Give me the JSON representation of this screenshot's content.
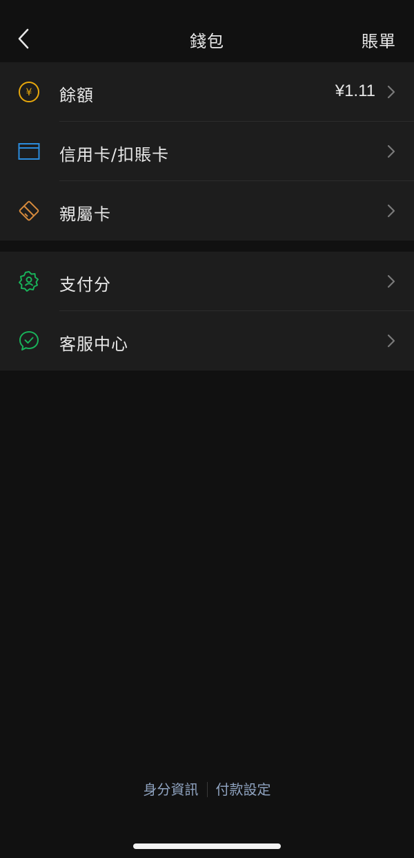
{
  "nav": {
    "back_icon": "chevron-left-icon",
    "title": "錢包",
    "bill_label": "賬單"
  },
  "groups": [
    {
      "items": [
        {
          "icon": "yuan-coin-icon",
          "label": "餘額",
          "value": "¥1.11",
          "color": "#e8a80c"
        },
        {
          "icon": "card-icon",
          "label": "信用卡/扣賬卡",
          "value": "",
          "color": "#2b8cdd"
        },
        {
          "icon": "family-card-icon",
          "label": "親屬卡",
          "value": "",
          "color": "#d68a3c"
        }
      ]
    },
    {
      "items": [
        {
          "icon": "pay-score-badge-icon",
          "label": "支付分",
          "value": "",
          "color": "#19b35a"
        },
        {
          "icon": "customer-service-icon",
          "label": "客服中心",
          "value": "",
          "color": "#19b35a"
        }
      ]
    }
  ],
  "footer": {
    "identity_label": "身分資訊",
    "payment_settings_label": "付款設定",
    "link_color": "#8fa3c0"
  },
  "colors": {
    "background": "#111111",
    "group_background": "#1d1d1d",
    "chevron": "#7a7a7a"
  }
}
